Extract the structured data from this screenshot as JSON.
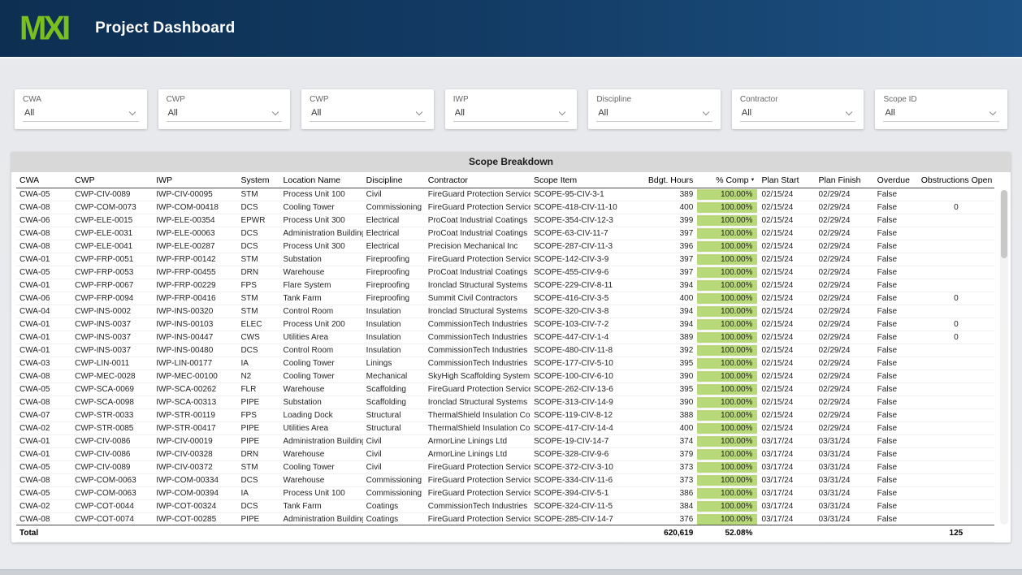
{
  "header": {
    "logo": "MXI",
    "title": "Project Dashboard"
  },
  "filters": [
    {
      "label": "CWA",
      "value": "All"
    },
    {
      "label": "CWP",
      "value": "All"
    },
    {
      "label": "CWP",
      "value": "All"
    },
    {
      "label": "IWP",
      "value": "All"
    },
    {
      "label": "Discipline",
      "value": "All"
    },
    {
      "label": "Contractor",
      "value": "All"
    },
    {
      "label": "Scope ID",
      "value": "All"
    }
  ],
  "colors": {
    "logo_green": "#79bf1e",
    "header_navy_left": "#0d2f52",
    "header_navy_right": "#1d5183",
    "bar_green": "#b8d97a"
  },
  "table": {
    "title": "Scope Breakdown",
    "columns": [
      "CWA",
      "CWP",
      "IWP",
      "System",
      "Location Name",
      "Discipline",
      "Contractor",
      "Scope Item",
      "Bdgt. Hours",
      "% Comp",
      "Plan Start",
      "Plan Finish",
      "Overdue",
      "Obstructions Open"
    ],
    "sort": {
      "column": "% Comp",
      "icon": "sort-descending-icon",
      "glyph": "▼"
    },
    "rows": [
      [
        "CWA-05",
        "CWP-CIV-0089",
        "IWP-CIV-00095",
        "STM",
        "Process Unit 100",
        "Civil",
        "FireGuard Protection Services",
        "SCOPE-95-CIV-3-1",
        "389",
        "100.00%",
        "02/15/24",
        "02/29/24",
        "False",
        ""
      ],
      [
        "CWA-08",
        "CWP-COM-0073",
        "IWP-COM-00418",
        "DCS",
        "Cooling Tower",
        "Commissioning",
        "FireGuard Protection Services",
        "SCOPE-418-CIV-11-10",
        "400",
        "100.00%",
        "02/15/24",
        "02/29/24",
        "False",
        "0"
      ],
      [
        "CWA-06",
        "CWP-ELE-0015",
        "IWP-ELE-00354",
        "EPWR",
        "Process Unit 300",
        "Electrical",
        "ProCoat Industrial Coatings",
        "SCOPE-354-CIV-12-3",
        "399",
        "100.00%",
        "02/15/24",
        "02/29/24",
        "False",
        ""
      ],
      [
        "CWA-08",
        "CWP-ELE-0031",
        "IWP-ELE-00063",
        "DCS",
        "Administration Building",
        "Electrical",
        "ProCoat Industrial Coatings",
        "SCOPE-63-CIV-11-7",
        "397",
        "100.00%",
        "02/15/24",
        "02/29/24",
        "False",
        ""
      ],
      [
        "CWA-08",
        "CWP-ELE-0041",
        "IWP-ELE-00287",
        "DCS",
        "Process Unit 300",
        "Electrical",
        "Precision Mechanical Inc",
        "SCOPE-287-CIV-11-3",
        "396",
        "100.00%",
        "02/15/24",
        "02/29/24",
        "False",
        ""
      ],
      [
        "CWA-01",
        "CWP-FRP-0051",
        "IWP-FRP-00142",
        "STM",
        "Substation",
        "Fireproofing",
        "FireGuard Protection Services",
        "SCOPE-142-CIV-3-9",
        "397",
        "100.00%",
        "02/15/24",
        "02/29/24",
        "False",
        ""
      ],
      [
        "CWA-05",
        "CWP-FRP-0053",
        "IWP-FRP-00455",
        "DRN",
        "Warehouse",
        "Fireproofing",
        "ProCoat Industrial Coatings",
        "SCOPE-455-CIV-9-6",
        "397",
        "100.00%",
        "02/15/24",
        "02/29/24",
        "False",
        ""
      ],
      [
        "CWA-01",
        "CWP-FRP-0067",
        "IWP-FRP-00229",
        "FPS",
        "Flare System",
        "Fireproofing",
        "Ironclad Structural Systems",
        "SCOPE-229-CIV-8-11",
        "394",
        "100.00%",
        "02/15/24",
        "02/29/24",
        "False",
        ""
      ],
      [
        "CWA-06",
        "CWP-FRP-0094",
        "IWP-FRP-00416",
        "STM",
        "Tank Farm",
        "Fireproofing",
        "Summit Civil Contractors",
        "SCOPE-416-CIV-3-5",
        "400",
        "100.00%",
        "02/15/24",
        "02/29/24",
        "False",
        "0"
      ],
      [
        "CWA-04",
        "CWP-INS-0002",
        "IWP-INS-00320",
        "STM",
        "Control Room",
        "Insulation",
        "Ironclad Structural Systems",
        "SCOPE-320-CIV-3-8",
        "394",
        "100.00%",
        "02/15/24",
        "02/29/24",
        "False",
        ""
      ],
      [
        "CWA-01",
        "CWP-INS-0037",
        "IWP-INS-00103",
        "ELEC",
        "Process Unit 200",
        "Insulation",
        "CommissionTech Industries",
        "SCOPE-103-CIV-7-2",
        "394",
        "100.00%",
        "02/15/24",
        "02/29/24",
        "False",
        "0"
      ],
      [
        "CWA-01",
        "CWP-INS-0037",
        "IWP-INS-00447",
        "CWS",
        "Utilities Area",
        "Insulation",
        "CommissionTech Industries",
        "SCOPE-447-CIV-1-4",
        "389",
        "100.00%",
        "02/15/24",
        "02/29/24",
        "False",
        "0"
      ],
      [
        "CWA-01",
        "CWP-INS-0037",
        "IWP-INS-00480",
        "DCS",
        "Control Room",
        "Insulation",
        "CommissionTech Industries",
        "SCOPE-480-CIV-11-8",
        "392",
        "100.00%",
        "02/15/24",
        "02/29/24",
        "False",
        ""
      ],
      [
        "CWA-03",
        "CWP-LIN-0011",
        "IWP-LIN-00177",
        "IA",
        "Cooling Tower",
        "Linings",
        "CommissionTech Industries",
        "SCOPE-177-CIV-5-10",
        "395",
        "100.00%",
        "02/15/24",
        "02/29/24",
        "False",
        ""
      ],
      [
        "CWA-08",
        "CWP-MEC-0028",
        "IWP-MEC-00100",
        "N2",
        "Cooling Tower",
        "Mechanical",
        "SkyHigh Scaffolding Systems",
        "SCOPE-100-CIV-6-10",
        "390",
        "100.00%",
        "02/15/24",
        "02/29/24",
        "False",
        ""
      ],
      [
        "CWA-05",
        "CWP-SCA-0069",
        "IWP-SCA-00262",
        "FLR",
        "Warehouse",
        "Scaffolding",
        "FireGuard Protection Services",
        "SCOPE-262-CIV-13-6",
        "395",
        "100.00%",
        "02/15/24",
        "02/29/24",
        "False",
        ""
      ],
      [
        "CWA-08",
        "CWP-SCA-0098",
        "IWP-SCA-00313",
        "PIPE",
        "Substation",
        "Scaffolding",
        "Ironclad Structural Systems",
        "SCOPE-313-CIV-14-9",
        "390",
        "100.00%",
        "02/15/24",
        "02/29/24",
        "False",
        ""
      ],
      [
        "CWA-07",
        "CWP-STR-0033",
        "IWP-STR-00119",
        "FPS",
        "Loading Dock",
        "Structural",
        "ThermalShield Insulation Co",
        "SCOPE-119-CIV-8-12",
        "388",
        "100.00%",
        "02/15/24",
        "02/29/24",
        "False",
        ""
      ],
      [
        "CWA-02",
        "CWP-STR-0085",
        "IWP-STR-00417",
        "PIPE",
        "Utilities Area",
        "Structural",
        "ThermalShield Insulation Co",
        "SCOPE-417-CIV-14-4",
        "400",
        "100.00%",
        "02/15/24",
        "02/29/24",
        "False",
        ""
      ],
      [
        "CWA-01",
        "CWP-CIV-0086",
        "IWP-CIV-00019",
        "PIPE",
        "Administration Building",
        "Civil",
        "ArmorLine Linings Ltd",
        "SCOPE-19-CIV-14-7",
        "374",
        "100.00%",
        "03/17/24",
        "03/31/24",
        "False",
        ""
      ],
      [
        "CWA-01",
        "CWP-CIV-0086",
        "IWP-CIV-00328",
        "DRN",
        "Warehouse",
        "Civil",
        "ArmorLine Linings Ltd",
        "SCOPE-328-CIV-9-6",
        "379",
        "100.00%",
        "03/17/24",
        "03/31/24",
        "False",
        ""
      ],
      [
        "CWA-05",
        "CWP-CIV-0089",
        "IWP-CIV-00372",
        "STM",
        "Cooling Tower",
        "Civil",
        "FireGuard Protection Services",
        "SCOPE-372-CIV-3-10",
        "373",
        "100.00%",
        "03/17/24",
        "03/31/24",
        "False",
        ""
      ],
      [
        "CWA-08",
        "CWP-COM-0063",
        "IWP-COM-00334",
        "DCS",
        "Warehouse",
        "Commissioning",
        "FireGuard Protection Services",
        "SCOPE-334-CIV-11-6",
        "373",
        "100.00%",
        "03/17/24",
        "03/31/24",
        "False",
        ""
      ],
      [
        "CWA-05",
        "CWP-COM-0063",
        "IWP-COM-00394",
        "IA",
        "Process Unit 100",
        "Commissioning",
        "FireGuard Protection Services",
        "SCOPE-394-CIV-5-1",
        "386",
        "100.00%",
        "03/17/24",
        "03/31/24",
        "False",
        ""
      ],
      [
        "CWA-02",
        "CWP-COT-0044",
        "IWP-COT-00324",
        "DCS",
        "Tank Farm",
        "Coatings",
        "CommissionTech Industries",
        "SCOPE-324-CIV-11-5",
        "384",
        "100.00%",
        "03/17/24",
        "03/31/24",
        "False",
        ""
      ],
      [
        "CWA-08",
        "CWP-COT-0074",
        "IWP-COT-00285",
        "PIPE",
        "Administration Building",
        "Coatings",
        "FireGuard Protection Services",
        "SCOPE-285-CIV-14-7",
        "376",
        "100.00%",
        "03/17/24",
        "03/31/24",
        "False",
        ""
      ]
    ],
    "total_row": [
      "Total",
      "",
      "",
      "",
      "",
      "",
      "",
      "",
      "620,619",
      "52.08%",
      "",
      "",
      "",
      "125"
    ]
  }
}
